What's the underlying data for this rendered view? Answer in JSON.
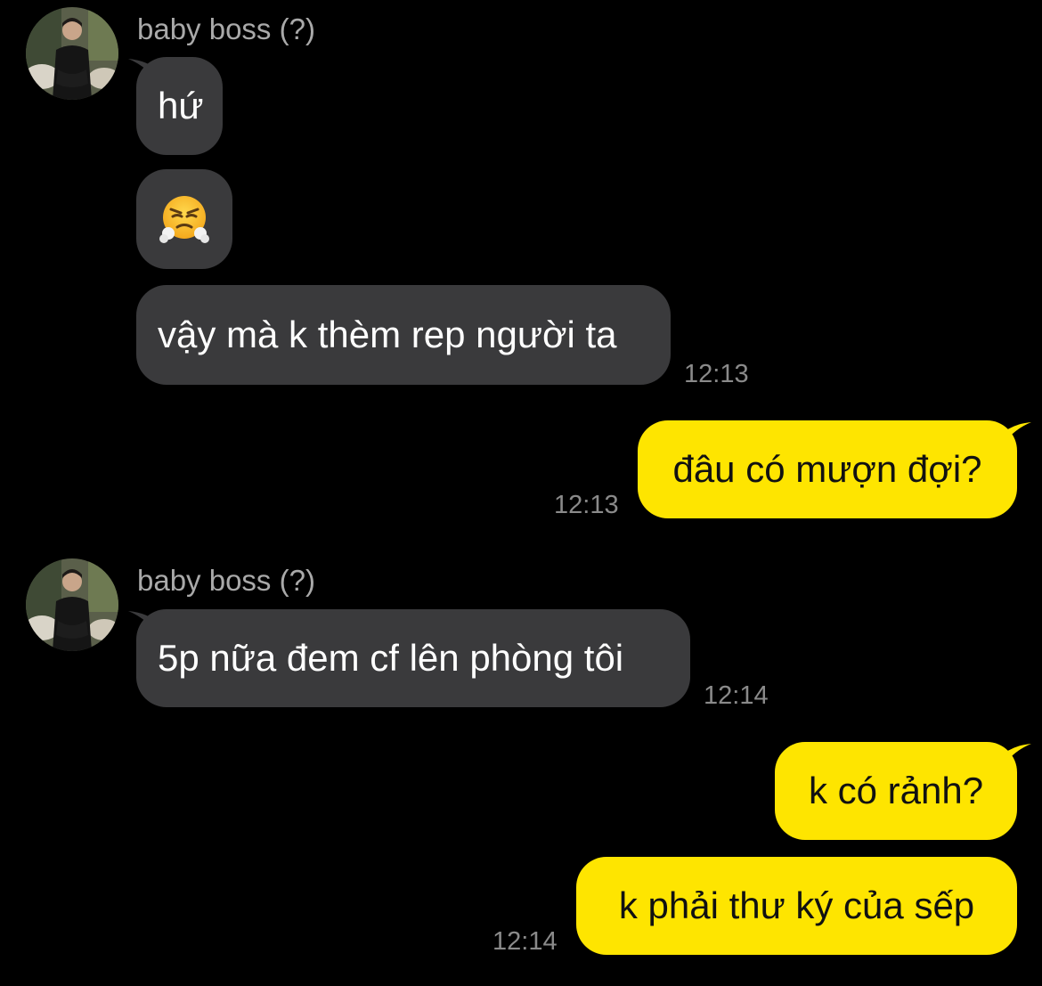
{
  "colors": {
    "background": "#000000",
    "incoming_bubble": "#3a3a3c",
    "outgoing_bubble": "#fee500",
    "sender_text": "#a9a9a9",
    "timestamp_text": "#8a8a8a"
  },
  "chat": {
    "group1": {
      "sender": "baby boss (?)",
      "messages": [
        "hứ",
        "vậy mà k thèm rep người ta"
      ],
      "emoji": "face-with-steam-from-nose-icon",
      "time": "12:13"
    },
    "reply1": {
      "text": "đâu có mượn đợi?",
      "time": "12:13"
    },
    "group2": {
      "sender": "baby boss (?)",
      "message": "5p nữa đem cf lên phòng tôi",
      "time": "12:14"
    },
    "reply2": {
      "messages": [
        "k có rảnh?",
        "k phải thư ký của sếp"
      ],
      "time": "12:14"
    }
  }
}
